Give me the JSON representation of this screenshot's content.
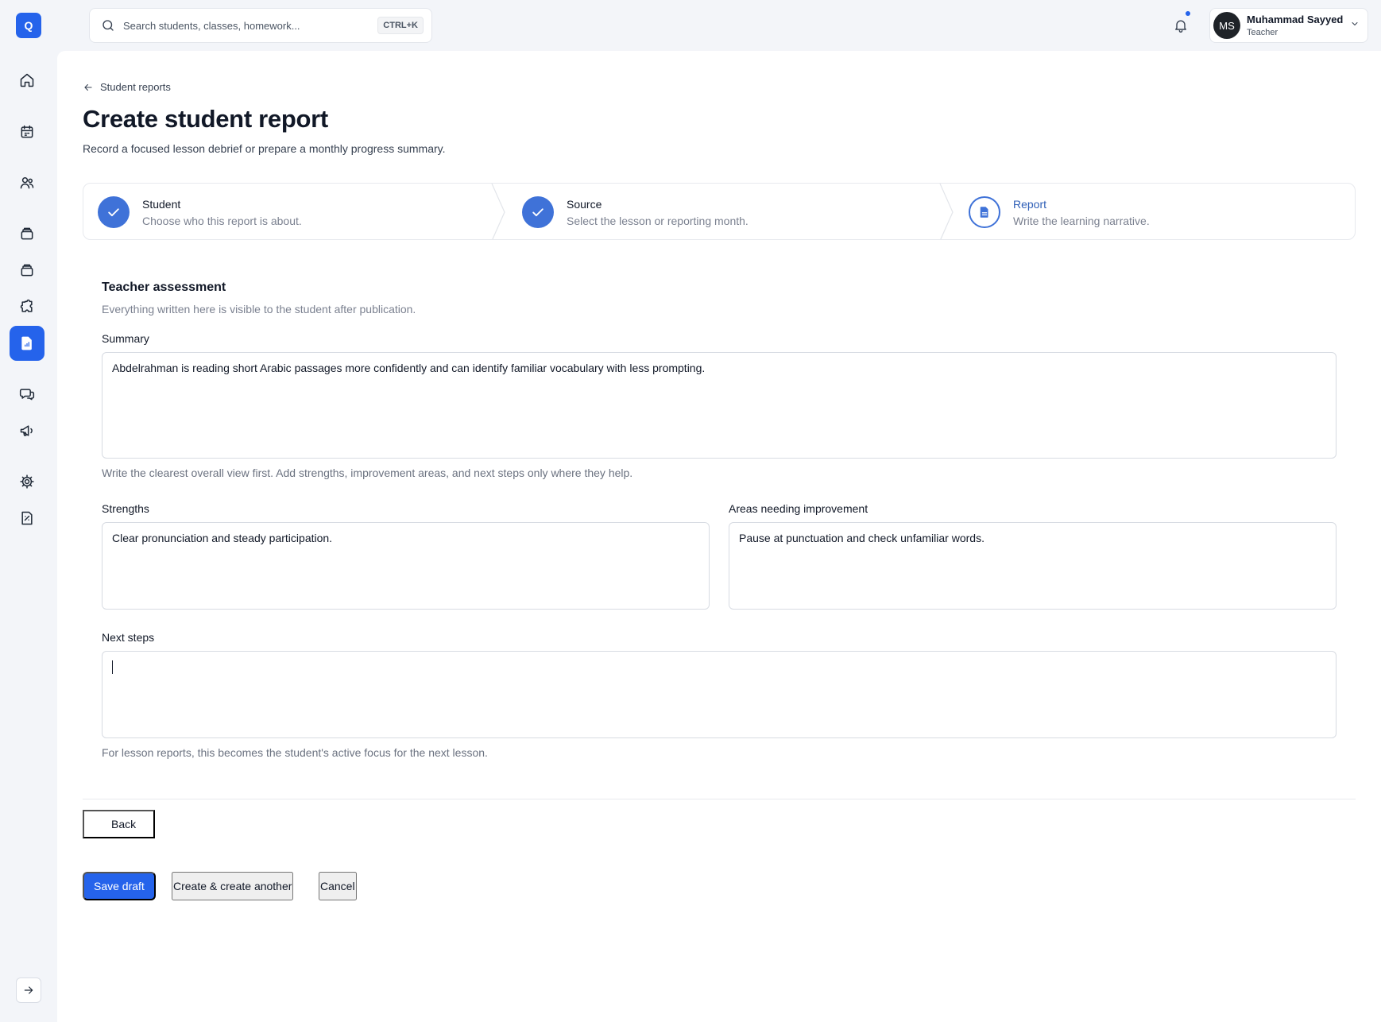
{
  "app": {
    "logo_letter": "Q"
  },
  "search": {
    "placeholder": "Search students, classes, homework...",
    "shortcut": "CTRL+K"
  },
  "user": {
    "initials": "MS",
    "name": "Muhammad Sayyed",
    "role": "Teacher"
  },
  "sidebar": {
    "items": [
      {
        "icon": "home-icon",
        "active": false
      },
      {
        "icon": "calendar-icon",
        "active": false
      },
      {
        "icon": "users-icon",
        "active": false
      },
      {
        "icon": "layers-icon",
        "active": false
      },
      {
        "icon": "layers-icon",
        "active": false
      },
      {
        "icon": "puzzle-icon",
        "active": false
      },
      {
        "icon": "report-icon",
        "active": true
      },
      {
        "icon": "chat-icon",
        "active": false
      },
      {
        "icon": "megaphone-icon",
        "active": false
      },
      {
        "icon": "gear-icon",
        "active": false
      },
      {
        "icon": "receipt-icon",
        "active": false
      }
    ],
    "collapse_icon": "arrow-right-icon"
  },
  "page": {
    "breadcrumb": "Student reports",
    "title": "Create student report",
    "subtitle": "Record a focused lesson debrief or prepare a monthly progress summary."
  },
  "steps": [
    {
      "title": "Student",
      "desc": "Choose who this report is about.",
      "state": "done"
    },
    {
      "title": "Source",
      "desc": "Select the lesson or reporting month.",
      "state": "done"
    },
    {
      "title": "Report",
      "desc": "Write the learning narrative.",
      "state": "current"
    }
  ],
  "form": {
    "section_title": "Teacher assessment",
    "section_desc": "Everything written here is visible to the student after publication.",
    "summary_label": "Summary",
    "summary_value": "Abdelrahman is reading short Arabic passages more confidently and can identify familiar vocabulary with less prompting.",
    "summary_hint": "Write the clearest overall view first. Add strengths, improvement areas, and next steps only where they help.",
    "strengths_label": "Strengths",
    "strengths_value": "Clear pronunciation and steady participation.",
    "improvement_label": "Areas needing improvement",
    "improvement_value": "Pause at punctuation and check unfamiliar words.",
    "next_steps_label": "Next steps",
    "next_steps_value": "",
    "next_steps_hint": "For lesson reports, this becomes the student's active focus for the next lesson."
  },
  "actions": {
    "back": "Back",
    "save_draft": "Save draft",
    "create_another": "Create & create another",
    "cancel": "Cancel"
  },
  "colors": {
    "accent": "#2563eb",
    "step_done": "#3f72d8",
    "step_current_text": "#2f5fb7"
  }
}
